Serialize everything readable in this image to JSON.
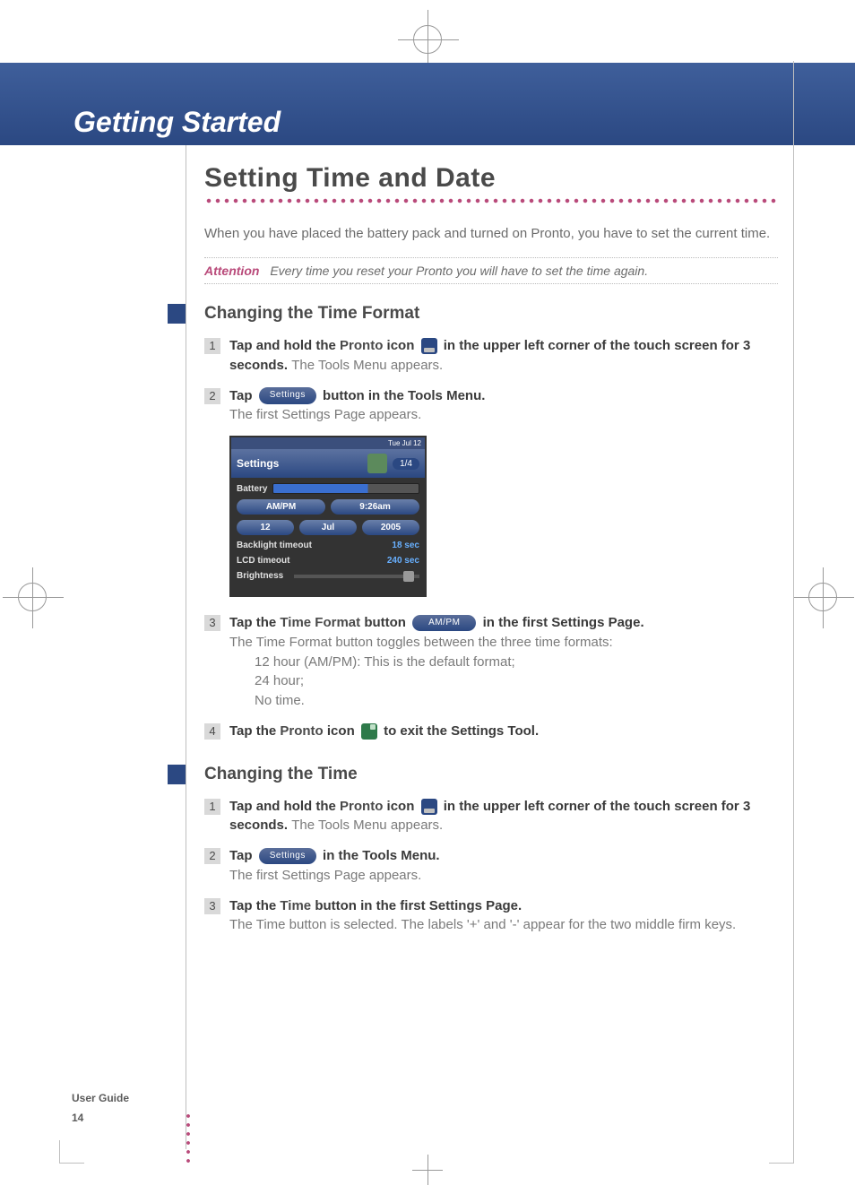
{
  "chapter": "Getting Started",
  "title": "Setting Time and Date",
  "intro": "When you have placed the battery pack and turned on Pronto, you have to set the current time.",
  "attention_label": "Attention",
  "attention_text": "Every time you reset your Pronto you will have to set the time again.",
  "section1": {
    "heading": "Changing the Time Format",
    "step1_a": "Tap and hold the ",
    "step1_b": "Pronto",
    "step1_c": " icon ",
    "step1_d": " in the upper left corner of the touch screen for 3 seconds. ",
    "step1_e": "The Tools Menu appears.",
    "step2_a": "Tap ",
    "step2_pill": "Settings",
    "step2_b": " button in the Tools Menu.",
    "step2_c": "The first Settings Page appears.",
    "step3_a": "Tap the ",
    "step3_b": "Time Format",
    "step3_c": " button ",
    "step3_pill": "AM/PM",
    "step3_d": " in the first Settings Page.",
    "step3_e": "The Time Format button toggles between the three time formats:",
    "step3_f1": "12 hour (AM/PM): This is the default format;",
    "step3_f2": "24 hour;",
    "step3_f3": "No time.",
    "step4_a": "Tap the ",
    "step4_b": "Pronto",
    "step4_c": " icon ",
    "step4_d": " to exit the Settings Tool."
  },
  "device": {
    "topbar_left": "",
    "topbar_right": "Tue Jul 12",
    "header_title": "Settings",
    "header_page": "1/4",
    "battery_label": "Battery",
    "ampm_label": "AM/PM",
    "time_value": "9:26am",
    "day": "12",
    "month": "Jul",
    "year": "2005",
    "backlight_label": "Backlight timeout",
    "backlight_value": "18 sec",
    "lcd_label": "LCD timeout",
    "lcd_value": "240 sec",
    "brightness_label": "Brightness"
  },
  "section2": {
    "heading": "Changing the Time",
    "step1_a": "Tap and hold the ",
    "step1_b": "Pronto",
    "step1_c": " icon ",
    "step1_d": " in the upper left corner of the touch screen for 3 seconds. ",
    "step1_e": "The Tools Menu appears.",
    "step2_a": "Tap ",
    "step2_pill": "Settings",
    "step2_b": " in the Tools Menu.",
    "step2_c": "The first Settings Page appears.",
    "step3_a": "Tap the ",
    "step3_b": "Time",
    "step3_c": " button in the first Settings Page.",
    "step3_d": "The Time button is selected. The labels '+' and '-' appear for the two middle firm keys."
  },
  "footer_label": "User Guide",
  "footer_page": "14",
  "nums": {
    "n1": "1",
    "n2": "2",
    "n3": "3",
    "n4": "4"
  }
}
